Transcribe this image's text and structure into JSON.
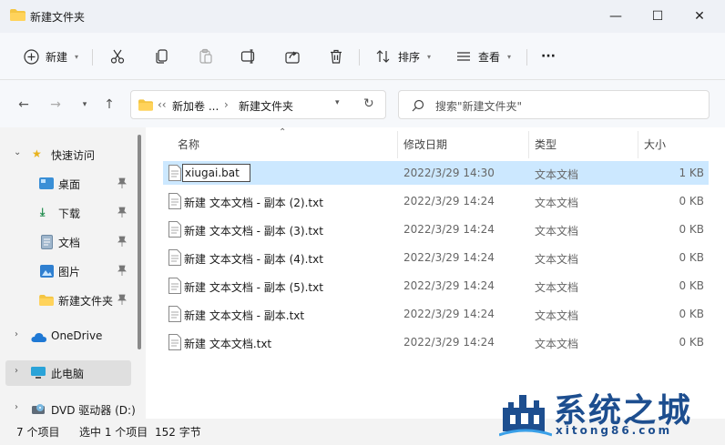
{
  "window": {
    "title": "新建文件夹",
    "controls": {
      "minimize": "—",
      "maximize": "☐",
      "close": "✕"
    }
  },
  "toolbar": {
    "new_label": "新建",
    "sort_label": "排序",
    "view_label": "查看",
    "more_label": "···"
  },
  "address": {
    "crumbs": [
      "‹‹",
      "新加卷 ...",
      "›",
      "新建文件夹"
    ],
    "search_placeholder": "搜索\"新建文件夹\""
  },
  "sidebar": {
    "items": [
      {
        "label": "快速访问",
        "icon": "star-icon"
      },
      {
        "label": "桌面",
        "icon": "desktop-icon"
      },
      {
        "label": "下载",
        "icon": "download-icon"
      },
      {
        "label": "文档",
        "icon": "document-icon"
      },
      {
        "label": "图片",
        "icon": "picture-icon"
      },
      {
        "label": "新建文件夹",
        "icon": "folder-icon"
      },
      {
        "label": "OneDrive",
        "icon": "cloud-icon"
      },
      {
        "label": "此电脑",
        "icon": "computer-icon"
      },
      {
        "label": "DVD 驱动器 (D:)",
        "icon": "dvd-icon"
      }
    ]
  },
  "columns": {
    "name": "名称",
    "date": "修改日期",
    "type": "类型",
    "size": "大小"
  },
  "files": [
    {
      "name": "xiugai.bat",
      "date": "2022/3/29 14:30",
      "type": "文本文档",
      "size": "1 KB"
    },
    {
      "name": "新建 文本文档 - 副本 (2).txt",
      "date": "2022/3/29 14:24",
      "type": "文本文档",
      "size": "0 KB"
    },
    {
      "name": "新建 文本文档 - 副本 (3).txt",
      "date": "2022/3/29 14:24",
      "type": "文本文档",
      "size": "0 KB"
    },
    {
      "name": "新建 文本文档 - 副本 (4).txt",
      "date": "2022/3/29 14:24",
      "type": "文本文档",
      "size": "0 KB"
    },
    {
      "name": "新建 文本文档 - 副本 (5).txt",
      "date": "2022/3/29 14:24",
      "type": "文本文档",
      "size": "0 KB"
    },
    {
      "name": "新建 文本文档 - 副本.txt",
      "date": "2022/3/29 14:24",
      "type": "文本文档",
      "size": "0 KB"
    },
    {
      "name": "新建 文本文档.txt",
      "date": "2022/3/29 14:24",
      "type": "文本文档",
      "size": "0 KB"
    }
  ],
  "status": {
    "count": "7 个项目",
    "selected": "选中 1 个项目",
    "size": "152 字节"
  },
  "watermark": {
    "main": "系统之城",
    "url": "xitong86.com"
  },
  "colors": {
    "accent": "#0067c0",
    "selection": "#cce8ff",
    "folder": "#f4c542",
    "watermark": "#1d4e8f"
  }
}
